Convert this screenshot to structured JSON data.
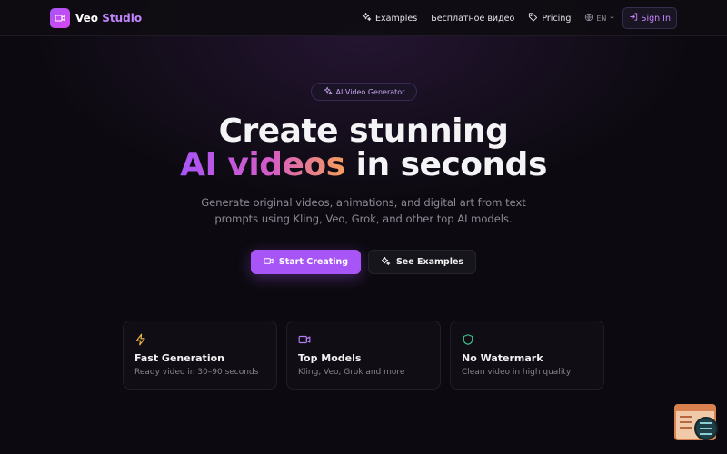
{
  "brand": {
    "name": "Veo",
    "name_accent": "Studio"
  },
  "nav": {
    "examples": "Examples",
    "free_video": "Бесплатное видео",
    "pricing": "Pricing",
    "language": "EN",
    "sign_in": "Sign In"
  },
  "hero": {
    "badge": "AI Video Generator",
    "title_line1": "Create stunning",
    "title_highlight": "AI videos",
    "title_rest": "in seconds",
    "subtitle_line1": "Generate original videos, animations, and digital art from text",
    "subtitle_line2": "prompts using Kling, Veo, Grok, and other top AI models.",
    "cta_primary": "Start Creating",
    "cta_secondary": "See Examples"
  },
  "features": [
    {
      "title": "Fast Generation",
      "description": "Ready video in 30–90 seconds",
      "icon": "lightning-icon",
      "color": "#f5b942"
    },
    {
      "title": "Top Models",
      "description": "Kling, Veo, Grok and more",
      "icon": "video-camera-icon",
      "color": "#b57cf5"
    },
    {
      "title": "No Watermark",
      "description": "Clean video in high quality",
      "icon": "shield-icon",
      "color": "#3fbf8a"
    }
  ],
  "colors": {
    "accent": "#a855f7",
    "background": "#0c0a10",
    "gradient_end": "#f59e5a"
  }
}
